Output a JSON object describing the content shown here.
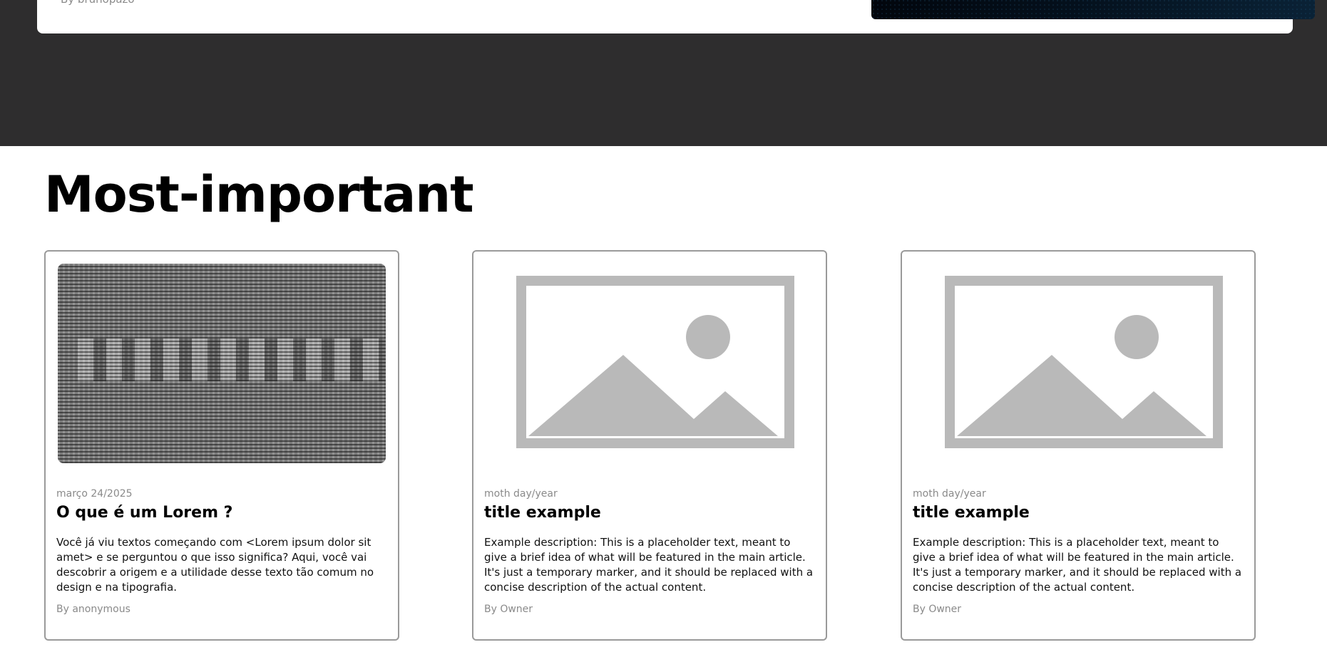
{
  "hero": {
    "author": "By brunopazo"
  },
  "section": {
    "title": "Most-important"
  },
  "cards": [
    {
      "thumbnail": "lorem-text-image",
      "date": "março 24/2025",
      "title": "O que é um Lorem ?",
      "description": "Você já viu textos começando com <Lorem ipsum dolor sit amet> e se perguntou o que isso significa? Aqui, você vai descobrir a origem e a utilidade desse texto tão comum no design e na tipografia.",
      "author": "By anonymous"
    },
    {
      "thumbnail": "image-placeholder-icon",
      "date": "moth day/year",
      "title": "title example",
      "description": "Example description: This is a placeholder text, meant to give a brief idea of what will be featured in the main article. It's just a temporary marker, and it should be replaced with a concise description of the actual content.",
      "author": "By Owner"
    },
    {
      "thumbnail": "image-placeholder-icon",
      "date": "moth day/year",
      "title": "title example",
      "description": "Example description: This is a placeholder text, meant to give a brief idea of what will be featured in the main article. It's just a temporary marker, and it should be replaced with a concise description of the actual content.",
      "author": "By Owner"
    }
  ],
  "colors": {
    "hero_background": "#2e2d2e",
    "card_border": "#9a9a9a",
    "muted_text": "#8a8a8a",
    "placeholder_gray": "#b9b9b9"
  }
}
